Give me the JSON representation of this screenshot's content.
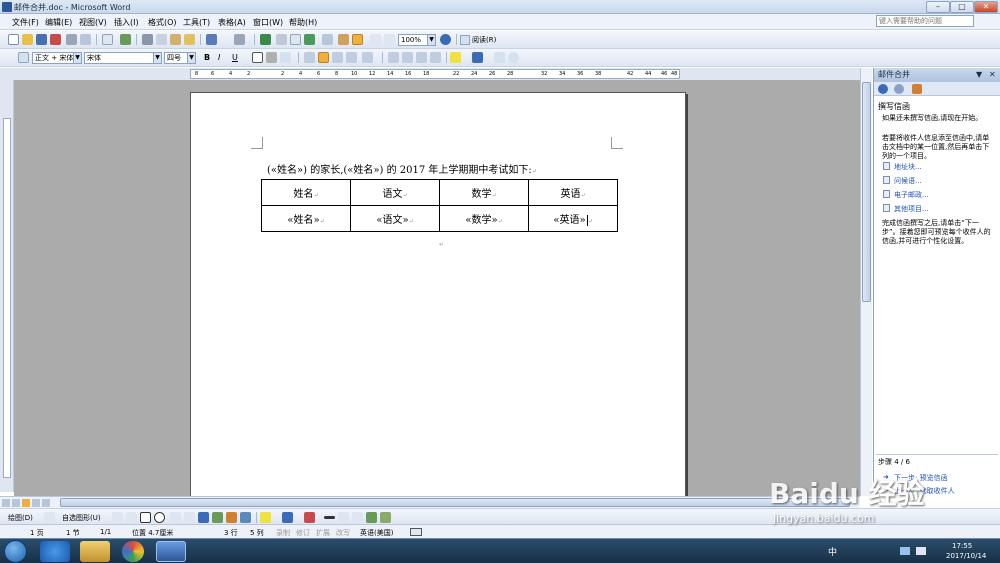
{
  "window": {
    "title": "邮件合并.doc - Microsoft Word",
    "minimize": "–",
    "maximize": "□",
    "close": "✕"
  },
  "menu": {
    "items": [
      "文件(F)",
      "编辑(E)",
      "视图(V)",
      "插入(I)",
      "格式(O)",
      "工具(T)",
      "表格(A)",
      "窗口(W)",
      "帮助(H)"
    ],
    "help_placeholder": "键入需要帮助的问题"
  },
  "standard_toolbar": {
    "zoom": "100%",
    "read_label": "阅读(R)"
  },
  "format_toolbar": {
    "style": "正文 + 宋体",
    "font": "宋体",
    "size": "四号",
    "bold": "B",
    "italic": "I",
    "underline": "U"
  },
  "ruler": {
    "ticks": [
      "8",
      "6",
      "4",
      "2",
      "2",
      "4",
      "6",
      "8",
      "10",
      "12",
      "14",
      "16",
      "18",
      "22",
      "24",
      "26",
      "28",
      "32",
      "34",
      "36",
      "38",
      "42",
      "44",
      "46",
      "48"
    ]
  },
  "document": {
    "letter_line": "(«姓名») 的家长,(«姓名») 的 2017 年上学期期中考试如下:",
    "table": {
      "headers": [
        "姓名",
        "语文",
        "数学",
        "英语"
      ],
      "row": [
        "«姓名»",
        "«语文»",
        "«数学»",
        "«英语»"
      ]
    }
  },
  "task_pane": {
    "title": "邮件合并",
    "section_title": "撰写信函",
    "p1": "如果还未撰写信函,请现在开始。",
    "p2": "若要将收件人信息添至信函中,请单击文档中的某一位置,然后再单击下列的一个项目。",
    "links": [
      "地址块...",
      "问候语...",
      "电子邮政...",
      "其他项目..."
    ],
    "p3": "完成信函撰写之后,请单击“下一步”。接着您即可预览每个收件人的信函,并可进行个性化设置。",
    "step": "步骤 4 / 6",
    "next": "下一步: 预览信函",
    "prev": "上一步: 选取收件人"
  },
  "draw_toolbar": {
    "draw": "绘图(D)",
    "autoshapes": "自选图形(U)"
  },
  "status": {
    "page": "1 页",
    "section": "1 节",
    "pos": "1/1",
    "at": "位置 4.7厘米",
    "line": "3 行",
    "col": "5 列",
    "rec": "录制",
    "trk": "修订",
    "ext": "扩展",
    "ovr": "改写",
    "lang": "英语(美国)"
  },
  "taskbar": {
    "ime": "中",
    "time": "17:55",
    "date": "2017/10/14"
  },
  "watermark": {
    "brand": "Baidu 经验",
    "url": "jingyan.baidu.com"
  },
  "colors": {
    "accent": "#3a6ab8",
    "taskbar": "#1f3a55",
    "doc_bg": "#ababab"
  }
}
